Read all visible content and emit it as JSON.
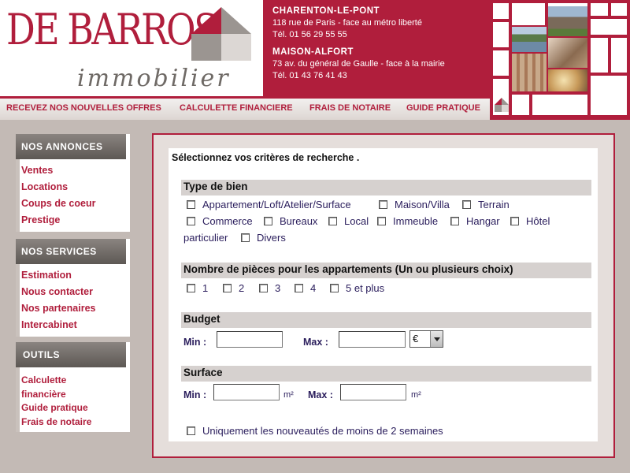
{
  "brand": {
    "name": "DE BARROS",
    "tagline": "immobilier",
    "colors": {
      "primary": "#b01e3c",
      "grey": "#6f6a66",
      "background": "#c3bab5"
    }
  },
  "agencies": [
    {
      "city": "CHARENTON-LE-PONT",
      "address": "118 rue de Paris - face au métro liberté",
      "phone": "Tél. 01 56 29 55 55"
    },
    {
      "city": "MAISON-ALFORT",
      "address": "73 av. du général de Gaulle - face à la mairie",
      "phone": "Tél. 01 43 76 41 43"
    }
  ],
  "top_nav": [
    "RECEVEZ NOS NOUVELLES OFFRES",
    "CALCULETTE FINANCIERE",
    "FRAIS DE NOTAIRE",
    "GUIDE PRATIQUE"
  ],
  "sidebar": {
    "annonces": {
      "title": "NOS ANNONCES",
      "items": [
        "Ventes",
        "Locations",
        "Coups de coeur",
        "Prestige"
      ]
    },
    "services": {
      "title": "NOS SERVICES",
      "items": [
        "Estimation",
        "Nous contacter",
        "Nos partenaires",
        "Intercabinet"
      ]
    },
    "outils": {
      "title": "OUTILS",
      "items": [
        "Calculette",
        "financière",
        "Guide pratique",
        "Frais de notaire"
      ]
    }
  },
  "form": {
    "intro": "Sélectionnez vos critères de recherche .",
    "type_bien": {
      "title": "Type de bien",
      "options": [
        "Appartement/Loft/Atelier/Surface",
        "Maison/Villa",
        "Terrain",
        "Commerce",
        "Bureaux",
        "Local",
        "Immeuble",
        "Hangar",
        "Hôtel",
        "particulier",
        "Divers"
      ]
    },
    "pieces": {
      "title": "Nombre de pièces pour les appartements (Un ou plusieurs choix)",
      "options": [
        "1",
        "2",
        "3",
        "4",
        "5 et plus"
      ]
    },
    "budget": {
      "title": "Budget",
      "min_label": "Min :",
      "max_label": "Max :",
      "min_value": "",
      "max_value": "",
      "currency": "€"
    },
    "surface": {
      "title": "Surface",
      "min_label": "Min :",
      "max_label": "Max :",
      "unit": "m²",
      "min_value": "",
      "max_value": ""
    },
    "nouveautes": "Uniquement les nouveautés de moins de 2 semaines"
  }
}
